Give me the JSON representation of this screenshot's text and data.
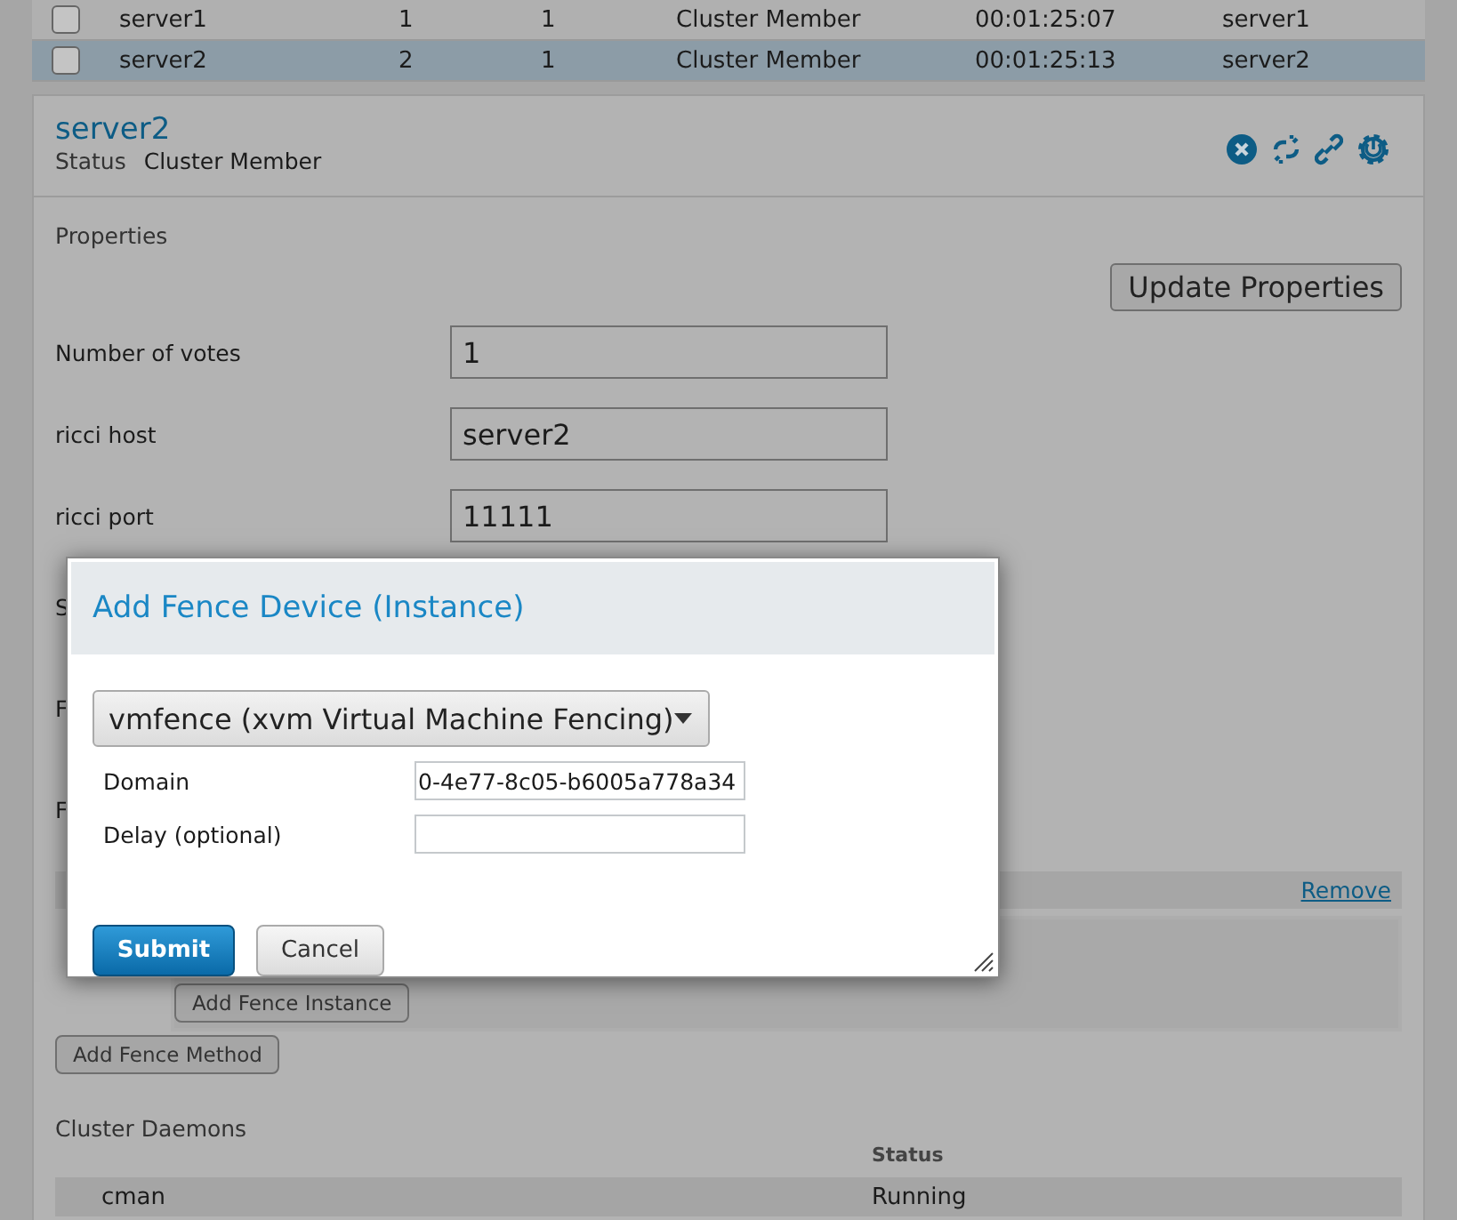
{
  "nodes_table": {
    "rows": [
      {
        "name": "server1",
        "col_2": "1",
        "col_3": "1",
        "status": "Cluster Member",
        "uptime": "00:01:25:07",
        "col_6": "server1",
        "checked": false,
        "selected": false
      },
      {
        "name": "server2",
        "col_2": "2",
        "col_3": "1",
        "status": "Cluster Member",
        "uptime": "00:01:25:13",
        "col_6": "server2",
        "checked": false,
        "selected": true
      }
    ]
  },
  "node_panel": {
    "title": "server2",
    "status_label": "Status",
    "status_value": "Cluster Member",
    "properties": {
      "heading": "Properties",
      "update_button": "Update Properties",
      "fields": [
        {
          "label": "Number of votes",
          "value": "1"
        },
        {
          "label": "ricci host",
          "value": "server2"
        },
        {
          "label": "ricci port",
          "value": "11111"
        }
      ]
    },
    "hidden_labels": [
      "S",
      "F",
      "F"
    ],
    "fence_method": {
      "remove_link": "Remove",
      "add_instance_button": "Add Fence Instance"
    },
    "add_method_button": "Add Fence Method",
    "daemons": {
      "heading": "Cluster Daemons",
      "status_header": "Status",
      "rows": [
        {
          "name": "cman",
          "status": "Running"
        }
      ]
    }
  },
  "dialog": {
    "title": "Add Fence Device (Instance)",
    "device_select": "vmfence (xvm Virtual Machine Fencing)",
    "fields": [
      {
        "label": "Domain",
        "value": "0-4e77-8c05-b6005a778a34"
      },
      {
        "label": "Delay (optional)"
      }
    ],
    "submit": "Submit",
    "cancel": "Cancel"
  }
}
